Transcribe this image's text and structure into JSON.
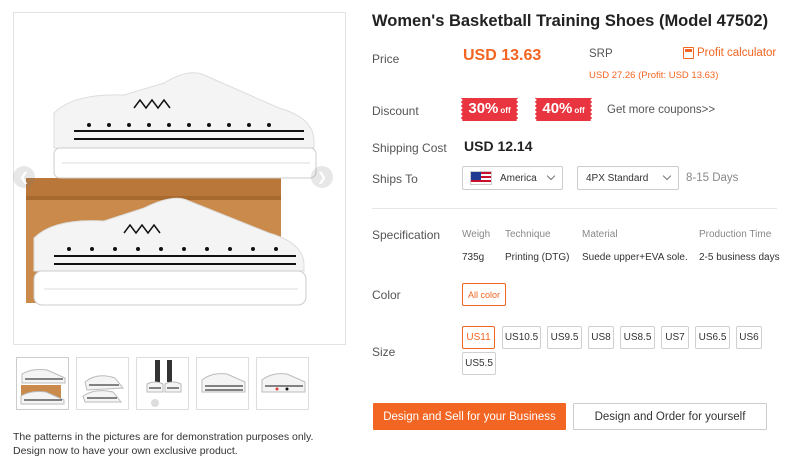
{
  "product": {
    "title": "Women's Basketball Training Shoes (Model 47502)",
    "note_line1": "The patterns in the pictures are for demonstration purposes only.",
    "note_line2": "Design now to have your own exclusive product."
  },
  "gallery": {
    "prev_icon": "chevron-left-icon",
    "next_icon": "chevron-right-icon",
    "main_image": "sneakers-on-shoebox",
    "thumbnails": [
      "sneakers-on-shoebox",
      "sneaker-pair-angle",
      "sneakers-worn",
      "sneaker-side",
      "sneaker-side-alt"
    ]
  },
  "price": {
    "label": "Price",
    "value": "USD 13.63"
  },
  "srp": {
    "label": "SRP",
    "detail": "USD 27.26 (Profit: USD 13.63)"
  },
  "profit_calculator": {
    "label": "Profit calculator",
    "icon": "calculator-icon"
  },
  "discount": {
    "label": "Discount",
    "coupons": [
      {
        "pct": "30%",
        "off": "off"
      },
      {
        "pct": "40%",
        "off": "off"
      }
    ],
    "more": "Get more coupons>>"
  },
  "shipping": {
    "label": "Shipping Cost",
    "value": "USD 12.14"
  },
  "ships_to": {
    "label": "Ships To",
    "country": "America",
    "country_icon": "us-flag-icon",
    "method": "4PX Standard",
    "days": "8-15 Days"
  },
  "specification": {
    "label": "Specification",
    "headers": [
      "Weigh",
      "Technique",
      "Material",
      "Production Time"
    ],
    "values": [
      "735g",
      "Printing (DTG)",
      "Suede upper+EVA sole.",
      "2-5 business days"
    ]
  },
  "color": {
    "label": "Color",
    "selected": "All color"
  },
  "size": {
    "label": "Size",
    "options": [
      "US11",
      "US10.5",
      "US9.5",
      "US8",
      "US8.5",
      "US7",
      "US6.5",
      "US6",
      "US5.5"
    ],
    "selected": "US11"
  },
  "actions": {
    "primary": "Design and Sell for your Business",
    "secondary": "Design and Order for yourself"
  },
  "colors": {
    "accent": "#f26522",
    "coupon": "#e8353f"
  }
}
